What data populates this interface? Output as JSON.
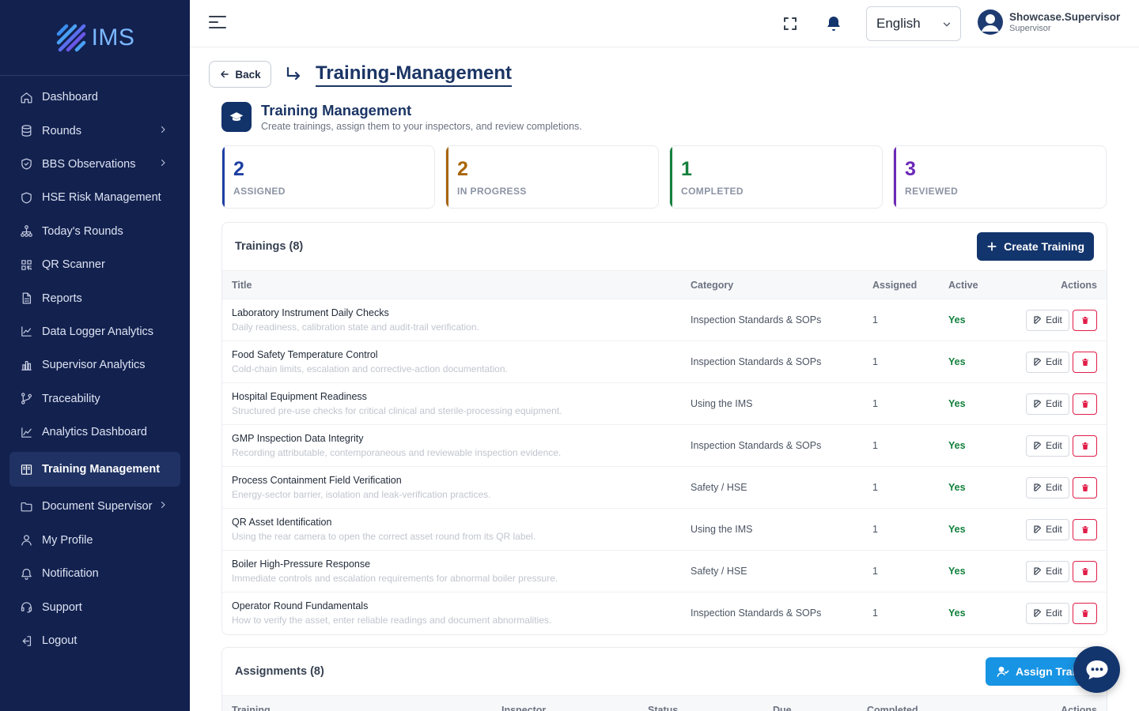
{
  "app": {
    "logo_text": "IMS"
  },
  "sidebar": {
    "items": [
      {
        "label": "Dashboard",
        "icon": "home-icon",
        "chevron": false
      },
      {
        "label": "Rounds",
        "icon": "database-icon",
        "chevron": true
      },
      {
        "label": "BBS Observations",
        "icon": "shield-check-icon",
        "chevron": true
      },
      {
        "label": "HSE Risk Management",
        "icon": "shield-icon",
        "chevron": false
      },
      {
        "label": "Today's Rounds",
        "icon": "hierarchy-icon",
        "chevron": false
      },
      {
        "label": "QR Scanner",
        "icon": "qr-code-icon",
        "chevron": false
      },
      {
        "label": "Reports",
        "icon": "document-icon",
        "chevron": false
      },
      {
        "label": "Data Logger Analytics",
        "icon": "line-chart-icon",
        "chevron": false
      },
      {
        "label": "Supervisor Analytics",
        "icon": "bar-chart-icon",
        "chevron": false
      },
      {
        "label": "Traceability",
        "icon": "git-branch-icon",
        "chevron": false
      },
      {
        "label": "Analytics Dashboard",
        "icon": "trend-chart-icon",
        "chevron": false
      },
      {
        "label": "Training Management",
        "icon": "book-open-icon",
        "chevron": false,
        "active": true
      },
      {
        "label": "Document Supervisor",
        "icon": "folder-icon",
        "chevron": true
      },
      {
        "label": "My Profile",
        "icon": "user-icon",
        "chevron": false
      },
      {
        "label": "Notification",
        "icon": "bell-icon",
        "chevron": false
      },
      {
        "label": "Support",
        "icon": "headset-icon",
        "chevron": false
      },
      {
        "label": "Logout",
        "icon": "logout-icon",
        "chevron": false
      }
    ]
  },
  "topbar": {
    "language": "English",
    "user_name": "Showcase.Supervisor",
    "user_role": "Supervisor"
  },
  "breadcrumb": {
    "back_label": "Back",
    "title": "Training-Management"
  },
  "header": {
    "title": "Training Management",
    "subtitle": "Create trainings, assign them to your inspectors, and review completions."
  },
  "stats": [
    {
      "value": "2",
      "label": "ASSIGNED",
      "color": "#1d3fa3"
    },
    {
      "value": "2",
      "label": "IN PROGRESS",
      "color": "#a8650b"
    },
    {
      "value": "1",
      "label": "COMPLETED",
      "color": "#15803d"
    },
    {
      "value": "3",
      "label": "REVIEWED",
      "color": "#6d28b8"
    }
  ],
  "trainings": {
    "title": "Trainings (8)",
    "create_label": "Create Training",
    "columns": [
      "Title",
      "Category",
      "Assigned",
      "Active",
      "Actions"
    ],
    "edit_label": "Edit",
    "rows": [
      {
        "title": "Laboratory Instrument Daily Checks",
        "desc": "Daily readiness, calibration state and audit-trail verification.",
        "category": "Inspection Standards & SOPs",
        "assigned": "1",
        "active": "Yes"
      },
      {
        "title": "Food Safety Temperature Control",
        "desc": "Cold-chain limits, escalation and corrective-action documentation.",
        "category": "Inspection Standards & SOPs",
        "assigned": "1",
        "active": "Yes"
      },
      {
        "title": "Hospital Equipment Readiness",
        "desc": "Structured pre-use checks for critical clinical and sterile-processing equipment.",
        "category": "Using the IMS",
        "assigned": "1",
        "active": "Yes"
      },
      {
        "title": "GMP Inspection Data Integrity",
        "desc": "Recording attributable, contemporaneous and reviewable inspection evidence.",
        "category": "Inspection Standards & SOPs",
        "assigned": "1",
        "active": "Yes"
      },
      {
        "title": "Process Containment Field Verification",
        "desc": "Energy-sector barrier, isolation and leak-verification practices.",
        "category": "Safety / HSE",
        "assigned": "1",
        "active": "Yes"
      },
      {
        "title": "QR Asset Identification",
        "desc": "Using the rear camera to open the correct asset round from its QR label.",
        "category": "Using the IMS",
        "assigned": "1",
        "active": "Yes"
      },
      {
        "title": "Boiler High-Pressure Response",
        "desc": "Immediate controls and escalation requirements for abnormal boiler pressure.",
        "category": "Safety / HSE",
        "assigned": "1",
        "active": "Yes"
      },
      {
        "title": "Operator Round Fundamentals",
        "desc": "How to verify the asset, enter reliable readings and document abnormalities.",
        "category": "Inspection Standards & SOPs",
        "assigned": "1",
        "active": "Yes"
      }
    ]
  },
  "assignments": {
    "title": "Assignments (8)",
    "assign_label": "Assign Training",
    "columns": [
      "Training",
      "Inspector",
      "Status",
      "Due",
      "Completed",
      "Actions"
    ]
  }
}
